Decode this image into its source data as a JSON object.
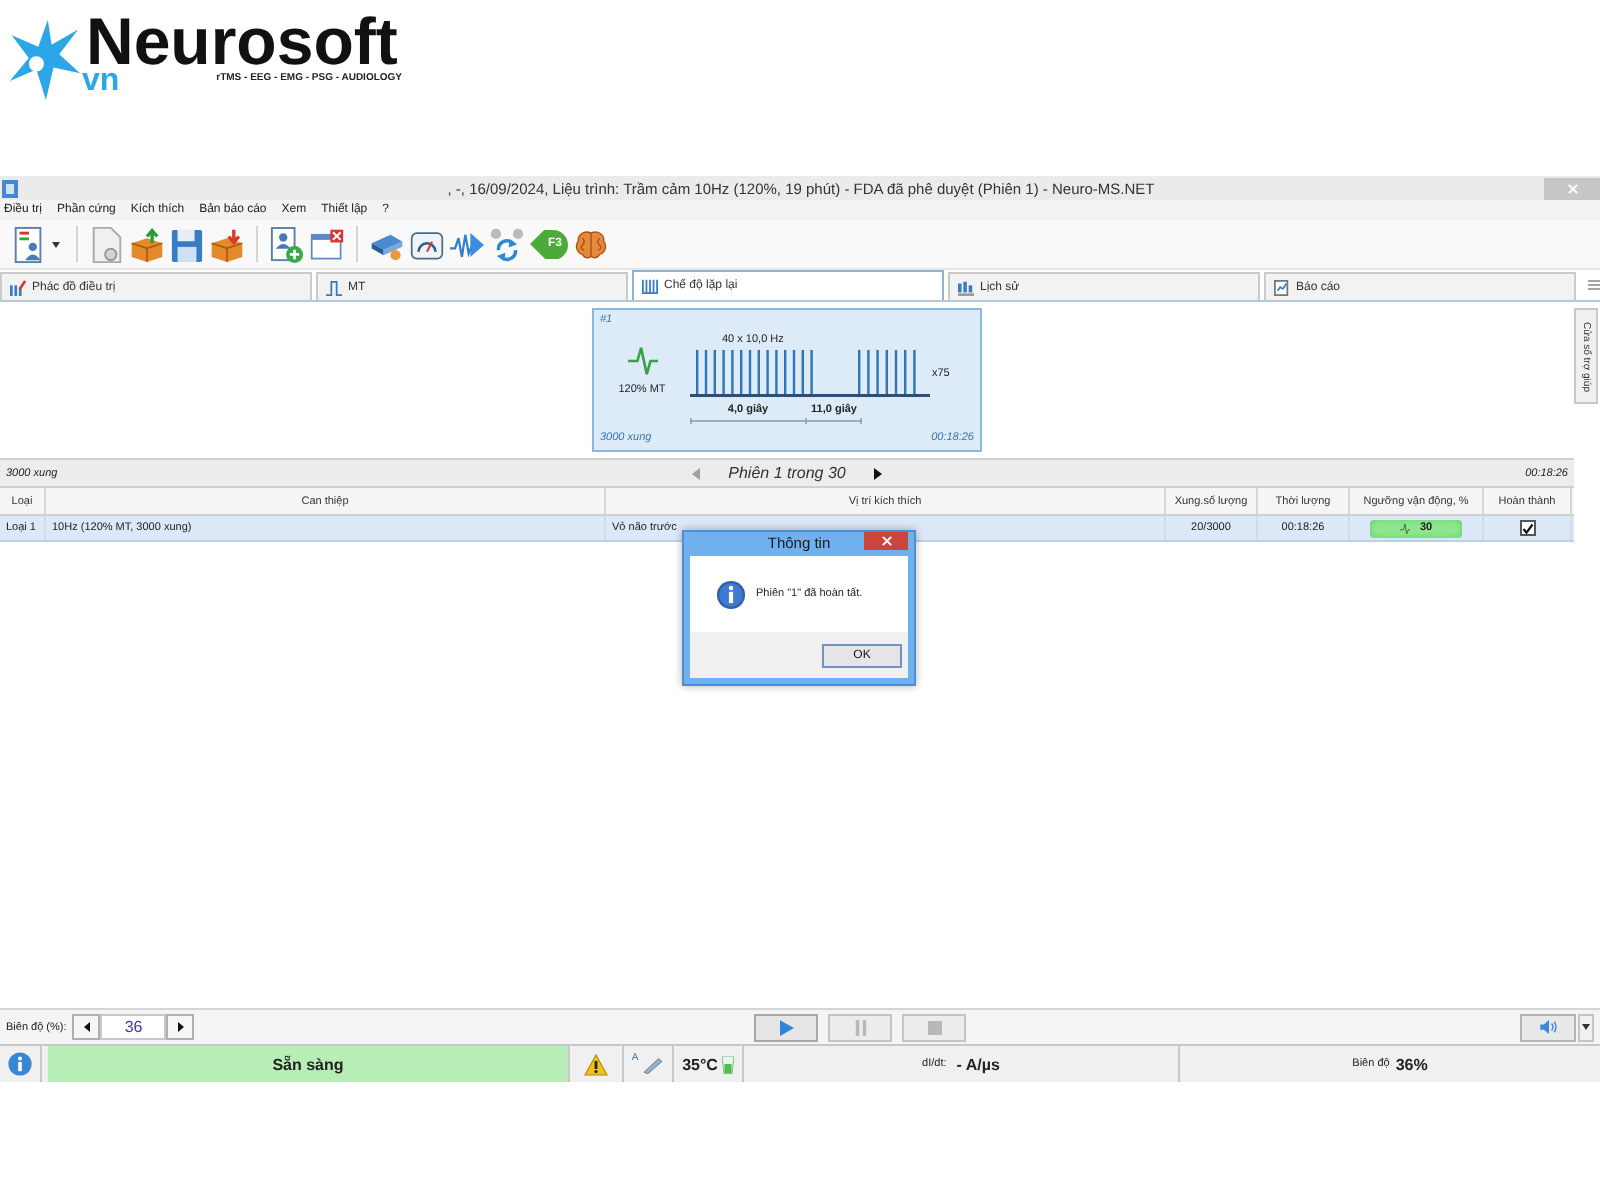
{
  "logo": {
    "name": "Neurosoft",
    "suffix": "vn",
    "tagline": "rTMS - EEG - EMG - PSG - AUDIOLOGY"
  },
  "window": {
    "title": ", -, 16/09/2024, Liệu trình: Trầm cảm 10Hz (120%, 19 phút) - FDA đã phê duyệt (Phiên 1) - Neuro-MS.NET"
  },
  "menu": [
    "Điều trị",
    "Phần cứng",
    "Kích thích",
    "Bản báo cáo",
    "Xem",
    "Thiết lập",
    "?"
  ],
  "toolbar": {
    "shortcut": "F3"
  },
  "tabs": [
    {
      "label": "Phác đồ điều trị",
      "selected": false
    },
    {
      "label": "MT",
      "selected": false
    },
    {
      "label": "Chế độ lặp lại",
      "selected": true
    },
    {
      "label": "Lịch sử",
      "selected": false
    },
    {
      "label": "Báo cáo",
      "selected": false
    }
  ],
  "side_panel": {
    "label": "Cửa sổ trợ giúp"
  },
  "protocol_card": {
    "number": "#1",
    "intensity": "120% MT",
    "train_label": "40 x 10,0 Hz",
    "repeat": "x75",
    "train_duration": "4,0 giây",
    "interval": "11,0 giây",
    "pulses": "3000 xung",
    "duration": "00:18:26"
  },
  "session_bar": {
    "pulses": "3000 xung",
    "can_go_back": false,
    "label": "Phiên 1 trong 30",
    "can_go_forward": true,
    "time": "00:18:26"
  },
  "table": {
    "columns": [
      "Loại",
      "Can thiệp",
      "Vị trí kích thích",
      "Xung.số lượng",
      "Thời lượng",
      "Ngưỡng vận động, %",
      "Hoàn thành"
    ],
    "rows": [
      {
        "selected": true,
        "cells": [
          "Loại 1",
          "10Hz (120% MT, 3000 xung)",
          "Vỏ não trước",
          "20/3000",
          "00:18:26"
        ],
        "threshold": "30",
        "completed": true
      }
    ]
  },
  "dialog": {
    "title": "Thông tin",
    "message": "Phiên \"1\" đã hoàn tất.",
    "button": "OK"
  },
  "amplitude": {
    "label": "Biên độ (%):",
    "value": "36"
  },
  "playback": [
    {
      "kind": "play",
      "disabled": false
    },
    {
      "kind": "pause",
      "disabled": true
    },
    {
      "kind": "stop",
      "disabled": true
    }
  ],
  "status_bar": {
    "ready": true,
    "state": "Sẵn sàng",
    "coil_label": "A",
    "temperature": "35°C",
    "didt_label": "dI/dt:",
    "didt_value": "- A/µs",
    "amplitude_label": "Biên độ",
    "amplitude_value": "36%"
  }
}
